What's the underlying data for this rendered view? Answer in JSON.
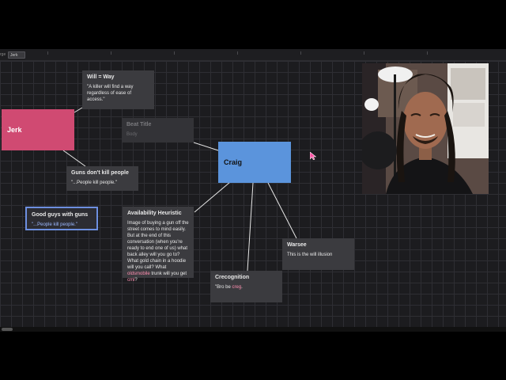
{
  "toolbar": {
    "tab_label": "Jerk",
    "side_mark": "rge"
  },
  "cards": {
    "will_way": {
      "title": "Will = Way",
      "body": "\"A killer will find a way regardless of ease of access.\""
    },
    "beat": {
      "title": "Beat Title",
      "body": "Body"
    },
    "guns_dont": {
      "title": "Guns don't kill people",
      "body": "\"...People kill people.\""
    },
    "good_guys": {
      "title": "Good guys with guns",
      "body": "\"...People kill people.\""
    },
    "availability": {
      "title": "Availability Heuristic",
      "body_a": "Image of buying a gun off the street comes to mind easily. But at the end of this conversation (when you're ready to end one of us) what back alley will you go to? What gold chain in a hoodie will you call? What ",
      "body_hl1": "oldsmobile",
      "body_b": " trunk will you get ",
      "body_hl2": "cmi",
      "body_c": "?"
    },
    "warsee": {
      "title": "Warsee",
      "body": "This is the will illusion"
    },
    "crecognition": {
      "title": "Crecognition",
      "body_a": "\"Bro be ",
      "body_hl": "creg",
      "body_c": "."
    }
  },
  "nodes": {
    "jerk": "Jerk",
    "craig": "Craig"
  },
  "colors": {
    "jerk": "#d04a72",
    "craig": "#5b94dc",
    "card": "#3b3b3f",
    "selected_border": "#6d8fe0",
    "cursor": "#ff4fa3"
  },
  "icons": {
    "cursor": "pointer-arrow-icon"
  }
}
